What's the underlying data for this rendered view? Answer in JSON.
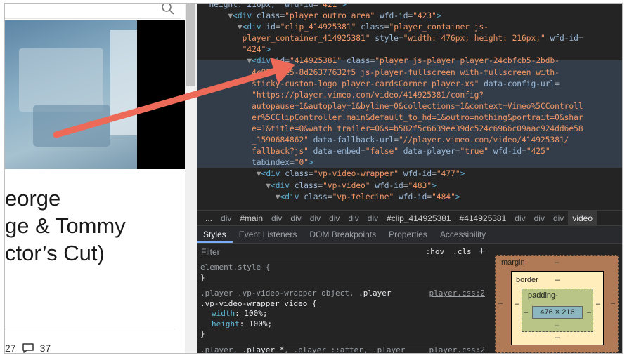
{
  "webpage": {
    "title_lines": [
      "eorge",
      "ge & Tommy",
      "ctor’s Cut)"
    ],
    "stats": {
      "likes": "27",
      "comments": "37"
    }
  },
  "devtools": {
    "code_lines": [
      {
        "indent": "  ",
        "html": "<span class='a'>height: 216px;\" </span><span class='a'>wfd-id</span><span class='p'>=</span><span class='v'>\"421\"</span><span class='t'>&gt;</span>"
      },
      {
        "indent": "      ",
        "html": "<span class='tri'>▼</span><span class='t'>&lt;div </span><span class='a'>class</span><span class='p'>=</span><span class='v'>\"player_outro_area\"</span> <span class='a'>wfd-id</span><span class='p'>=</span><span class='v'>\"423\"</span><span class='t'>&gt;</span>"
      },
      {
        "indent": "        ",
        "html": "<span class='tri'>▼</span><span class='t'>&lt;div </span><span class='a'>id</span><span class='p'>=</span><span class='v'>\"clip_414925381\"</span> <span class='a'>class</span><span class='p'>=</span><span class='v'>\"player_container js-</span>"
      },
      {
        "indent": "         ",
        "html": "<span class='v'>player_container_414925381\"</span> <span class='a'>style</span><span class='p'>=</span><span class='v'>\"width: 476px; height: 216px;\"</span> <span class='a'>wfd-id</span><span class='p'>=</span>"
      },
      {
        "indent": "         ",
        "html": "<span class='v'>\"424\"</span><span class='t'>&gt;</span>"
      },
      {
        "indent": "          ",
        "html": "<span class='tri'>▼</span><span class='t'>&lt;div </span><span class='a'>id</span><span class='p'>=</span><span class='v'>\"414925381\"</span> <span class='a'>class</span><span class='p'>=</span><span class='v'>\"player js-player player-24cbfcb5-2bdb-</span>"
      },
      {
        "indent": "           ",
        "html": "<span class='v'>4c99-9fe5-8d26377632f5 js-player-fullscreen with-fullscreen with-</span>"
      },
      {
        "indent": "           ",
        "html": "<span class='v'>sticky-custom-logo player-cardsCorner player-xs\"</span> <span class='a'>data-config-url</span><span class='p'>=</span>"
      },
      {
        "indent": "           ",
        "html": "<span class='v'>\"https://player.vimeo.com/video/414925381/config?</span>"
      },
      {
        "indent": "           ",
        "html": "<span class='v'>autopause=1&amp;autoplay=1&amp;byline=0&amp;collections=1&amp;context=Vimeo%5CControll</span>"
      },
      {
        "indent": "           ",
        "html": "<span class='v'>er%5CClipController.main&amp;default_to_hd=1&amp;outro=nothing&amp;portrait=0&amp;shar</span>"
      },
      {
        "indent": "           ",
        "html": "<span class='v'>e=1&amp;title=0&amp;watch_trailer=0&amp;s=b582f5c6639ee39dc524c6966c09aac924dd6e58</span>"
      },
      {
        "indent": "           ",
        "html": "<span class='v'>_1590684862\"</span> <span class='a'>data-fallback-url</span><span class='p'>=</span><span class='v'>\"//player.vimeo.com/video/414925381/</span>"
      },
      {
        "indent": "           ",
        "html": "<span class='v'>fallback?js\"</span> <span class='a'>data-embed</span><span class='p'>=</span><span class='v'>\"false\"</span> <span class='a'>data-player</span><span class='p'>=</span><span class='v'>\"true\"</span> <span class='a'>wfd-id</span><span class='p'>=</span><span class='v'>\"425\"</span>"
      },
      {
        "indent": "           ",
        "html": "<span class='a'>tabindex</span><span class='p'>=</span><span class='v'>\"0\"</span><span class='t'>&gt;</span>"
      },
      {
        "indent": "            ",
        "html": "<span class='tri'>▼</span><span class='t'>&lt;div </span><span class='a'>class</span><span class='p'>=</span><span class='v'>\"vp-video-wrapper\"</span> <span class='a'>wfd-id</span><span class='p'>=</span><span class='v'>\"477\"</span><span class='t'>&gt;</span>"
      },
      {
        "indent": "              ",
        "html": "<span class='tri'>▼</span><span class='t'>&lt;div </span><span class='a'>class</span><span class='p'>=</span><span class='v'>\"vp-video\"</span> <span class='a'>wfd-id</span><span class='p'>=</span><span class='v'>\"483\"</span><span class='t'>&gt;</span>"
      },
      {
        "indent": "                ",
        "html": "<span class='tri'>▼</span><span class='t'>&lt;div </span><span class='a'>class</span><span class='p'>=</span><span class='v'>\"vp-telecine\"</span> <span class='a'>wfd-id</span><span class='p'>=</span><span class='v'>\"484\"</span><span class='t'>&gt;</span>"
      },
      {
        "indent": "                  ",
        "html": "<span class='t'>&lt;video </span><span class='a'>preload</span> <span class='a'>tabindex</span><span class='p'>=</span><span class='v'>\"-1\"</span> <span class='a'>style</span> <span class='a'>src</span><span class='p'>=</span><span class='v'>\"blob:https://</span>"
      }
    ],
    "breadcrumbs": [
      "...",
      "div",
      "#main",
      "div",
      "div",
      "div",
      "div",
      "div",
      "div",
      "#clip_414925381",
      "#414925381",
      "div",
      "div",
      "div",
      "video"
    ],
    "tabs": [
      "Styles",
      "Event Listeners",
      "DOM Breakpoints",
      "Properties",
      "Accessibility"
    ],
    "filter": {
      "placeholder": "Filter",
      "hov": ":hov",
      "cls": ".cls",
      "plus": "+"
    },
    "rules": {
      "element_style": "element.style {",
      "close": "}",
      "rule1_sel_a": ".player .vp-video-wrapper object, ",
      "rule1_sel_b": ".player",
      "rule1_sel_c": ".vp-video-wrapper video {",
      "rule1_src": "player.css:2",
      "width_name": "width",
      "width_val": "100%;",
      "height_name": "height",
      "height_val": "100%;",
      "rule2_sel_a": ".player, ",
      "rule2_sel_b": ".player *",
      "rule2_sel_c": ", .player ::after, .player",
      "rule2_src": "player.css:2"
    },
    "boxmodel": {
      "margin": "margin",
      "border": "border",
      "padding": "padding-",
      "content": "476 × 216",
      "dash": "–"
    }
  },
  "colors": {
    "arrow": "#ec6a57",
    "selected_node": "#333d4a",
    "accent_tab": "#7cacf8"
  }
}
